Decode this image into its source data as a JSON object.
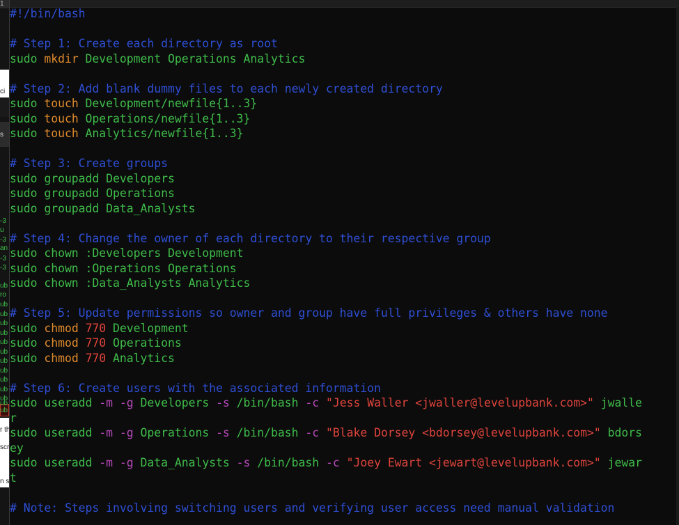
{
  "colors": {
    "background": "#0c0c0c",
    "comment": "#2f4fd6",
    "plain": "#3fbd4a",
    "keyword": "#e08a2c",
    "number": "#e0443c",
    "string": "#e0443c",
    "option": "#b548b8"
  },
  "background_fragments": [
    "1",
    "ci",
    "s",
    "-3",
    "u",
    "-3",
    "an",
    "-3",
    "-3",
    "ub",
    "ro",
    "ub",
    "ub",
    "ub",
    "ub",
    "ub",
    "ub",
    "ub",
    "ub",
    "ub",
    "ub",
    "ub",
    "ub",
    "ub",
    "r th",
    "scr",
    "n st"
  ],
  "editor": {
    "lines": [
      [
        {
          "t": "#!/bin/bash",
          "c": "comment"
        }
      ],
      [],
      [
        {
          "t": "# Step 1: Create each directory as root",
          "c": "comment"
        }
      ],
      [
        {
          "t": "sudo ",
          "c": "plain"
        },
        {
          "t": "mkdir",
          "c": "kw"
        },
        {
          "t": " Development Operations Analytics",
          "c": "plain"
        }
      ],
      [],
      [
        {
          "t": "# Step 2: Add blank dummy files to each newly created directory",
          "c": "comment"
        }
      ],
      [
        {
          "t": "sudo ",
          "c": "plain"
        },
        {
          "t": "touch",
          "c": "kw"
        },
        {
          "t": " Development/newfile{1..3}",
          "c": "plain"
        }
      ],
      [
        {
          "t": "sudo ",
          "c": "plain"
        },
        {
          "t": "touch",
          "c": "kw"
        },
        {
          "t": " Operations/newfile{1..3}",
          "c": "plain"
        }
      ],
      [
        {
          "t": "sudo ",
          "c": "plain"
        },
        {
          "t": "touch",
          "c": "kw"
        },
        {
          "t": " Analytics/newfile{1..3}",
          "c": "plain"
        }
      ],
      [],
      [
        {
          "t": "# Step 3: Create groups",
          "c": "comment"
        }
      ],
      [
        {
          "t": "sudo groupadd Developers",
          "c": "plain"
        }
      ],
      [
        {
          "t": "sudo groupadd Operations",
          "c": "plain"
        }
      ],
      [
        {
          "t": "sudo groupadd Data_Analysts",
          "c": "plain"
        }
      ],
      [],
      [
        {
          "t": "# Step 4: Change the owner of each directory to their respective group",
          "c": "comment"
        }
      ],
      [
        {
          "t": "sudo chown :Developers Development",
          "c": "plain"
        }
      ],
      [
        {
          "t": "sudo chown :Operations Operations",
          "c": "plain"
        }
      ],
      [
        {
          "t": "sudo chown :Data_Analysts Analytics",
          "c": "plain"
        }
      ],
      [],
      [
        {
          "t": "# Step 5: Update permissions so owner and group have full privileges & others have none",
          "c": "comment"
        }
      ],
      [
        {
          "t": "sudo ",
          "c": "plain"
        },
        {
          "t": "chmod",
          "c": "kw"
        },
        {
          "t": " ",
          "c": "plain"
        },
        {
          "t": "770",
          "c": "num"
        },
        {
          "t": " Development",
          "c": "plain"
        }
      ],
      [
        {
          "t": "sudo ",
          "c": "plain"
        },
        {
          "t": "chmod",
          "c": "kw"
        },
        {
          "t": " ",
          "c": "plain"
        },
        {
          "t": "770",
          "c": "num"
        },
        {
          "t": " Operations",
          "c": "plain"
        }
      ],
      [
        {
          "t": "sudo ",
          "c": "plain"
        },
        {
          "t": "chmod",
          "c": "kw"
        },
        {
          "t": " ",
          "c": "plain"
        },
        {
          "t": "770",
          "c": "num"
        },
        {
          "t": " Analytics",
          "c": "plain"
        }
      ],
      [],
      [
        {
          "t": "# Step 6: Create users with the associated information",
          "c": "comment"
        }
      ],
      [
        {
          "t": "sudo useradd ",
          "c": "plain"
        },
        {
          "t": "-m -g",
          "c": "opt"
        },
        {
          "t": " Developers ",
          "c": "plain"
        },
        {
          "t": "-s",
          "c": "opt"
        },
        {
          "t": " /bin/bash ",
          "c": "plain"
        },
        {
          "t": "-c",
          "c": "opt"
        },
        {
          "t": " ",
          "c": "plain"
        },
        {
          "t": "\"Jess Waller <jwaller@levelupbank.com>\"",
          "c": "str"
        },
        {
          "t": " jwalle",
          "c": "plain"
        }
      ],
      [
        {
          "t": "r",
          "c": "plain"
        }
      ],
      [
        {
          "t": "sudo useradd ",
          "c": "plain"
        },
        {
          "t": "-m -g",
          "c": "opt"
        },
        {
          "t": " Operations ",
          "c": "plain"
        },
        {
          "t": "-s",
          "c": "opt"
        },
        {
          "t": " /bin/bash ",
          "c": "plain"
        },
        {
          "t": "-c",
          "c": "opt"
        },
        {
          "t": " ",
          "c": "plain"
        },
        {
          "t": "\"Blake Dorsey <bdorsey@levelupbank.com>\"",
          "c": "str"
        },
        {
          "t": " bdors",
          "c": "plain"
        }
      ],
      [
        {
          "t": "ey",
          "c": "plain"
        }
      ],
      [
        {
          "t": "sudo useradd ",
          "c": "plain"
        },
        {
          "t": "-m -g",
          "c": "opt"
        },
        {
          "t": " Data_Analysts ",
          "c": "plain"
        },
        {
          "t": "-s",
          "c": "opt"
        },
        {
          "t": " /bin/bash ",
          "c": "plain"
        },
        {
          "t": "-c",
          "c": "opt"
        },
        {
          "t": " ",
          "c": "plain"
        },
        {
          "t": "\"Joey Ewart <jewart@levelupbank.com>\"",
          "c": "str"
        },
        {
          "t": " jewar",
          "c": "plain"
        }
      ],
      [
        {
          "t": "t",
          "c": "plain"
        }
      ],
      [],
      [
        {
          "t": "# Note: Steps involving switching users and verifying user access need manual validation",
          "c": "comment"
        }
      ]
    ]
  }
}
